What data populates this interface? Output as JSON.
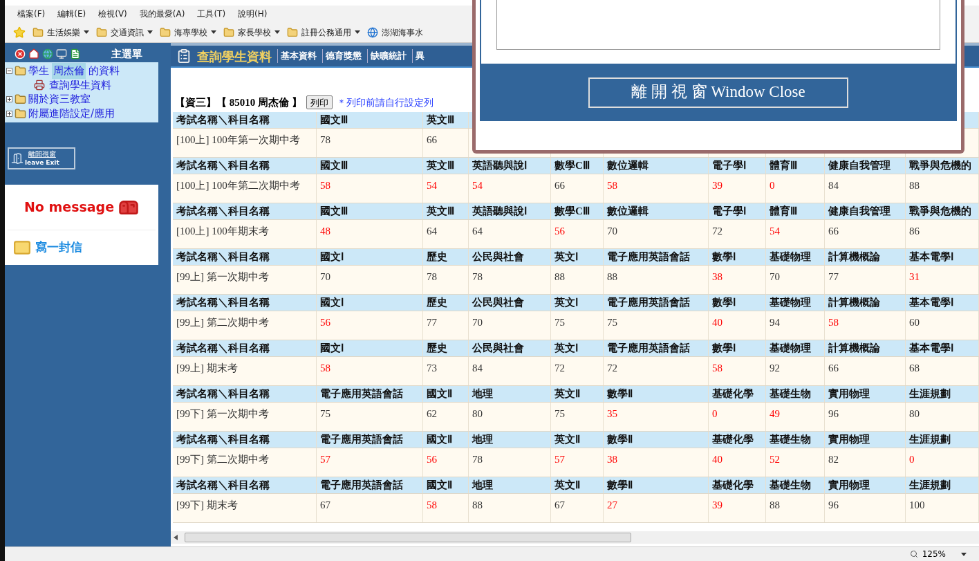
{
  "menu_bar": [
    "檔案(F)",
    "編輯(E)",
    "檢視(V)",
    "我的最愛(A)",
    "工具(T)",
    "說明(H)"
  ],
  "favorites_bar": [
    {
      "label": "生活娛樂",
      "kind": "folder"
    },
    {
      "label": "交通資訊",
      "kind": "folder"
    },
    {
      "label": "海專學校",
      "kind": "folder"
    },
    {
      "label": "家長學校",
      "kind": "folder"
    },
    {
      "label": "註冊公務通用",
      "kind": "folder"
    },
    {
      "label": "澎湖海事水",
      "kind": "page"
    }
  ],
  "sidebar": {
    "title": "主選單",
    "tree": [
      {
        "label_before": "學生",
        "highlight": "周杰倫",
        "label_after": "的資料",
        "expanded": true,
        "children": [
          {
            "label": "查詢學生資料"
          }
        ]
      },
      {
        "label_before": "關於資三教室",
        "expanded": false
      },
      {
        "label_before": "附屬進階設定/應用",
        "expanded": false
      }
    ],
    "leave_button": {
      "line1": "離開視窗",
      "line2": "leave Exit"
    },
    "message": "No message",
    "write_link": "寫一封信"
  },
  "header": {
    "title": "查詢學生資料",
    "tabs": [
      "基本資料",
      "德育獎懲",
      "缺曠統計",
      "異"
    ]
  },
  "student_line": {
    "class_name": "【資三】【 85010 周杰倫 】",
    "print_button": "列印",
    "note": "＊列印前請自行設定列"
  },
  "blocks": [
    {
      "headers": [
        "考試名稱＼科目名稱",
        "國文Ⅲ",
        "英文Ⅲ"
      ],
      "exam": "[100上] 100年第一次期中考",
      "scores": [
        {
          "value": "78",
          "fail": false
        },
        {
          "value": "66",
          "fail": false
        }
      ]
    },
    {
      "headers": [
        "考試名稱＼科目名稱",
        "國文Ⅲ",
        "英文Ⅲ",
        "英語聽與說Ⅰ",
        "數學CⅢ",
        "數位邏輯",
        "電子學Ⅰ",
        "體育Ⅲ",
        "健康自我管理",
        "戰爭與危機的"
      ],
      "exam": "[100上] 100年第二次期中考",
      "scores": [
        {
          "value": "58",
          "fail": true
        },
        {
          "value": "54",
          "fail": true
        },
        {
          "value": "54",
          "fail": true
        },
        {
          "value": "66",
          "fail": false
        },
        {
          "value": "58",
          "fail": true
        },
        {
          "value": "39",
          "fail": true
        },
        {
          "value": "0",
          "fail": true
        },
        {
          "value": "84",
          "fail": false
        },
        {
          "value": "88",
          "fail": false
        }
      ]
    },
    {
      "headers": [
        "考試名稱＼科目名稱",
        "國文Ⅲ",
        "英文Ⅲ",
        "英語聽與說Ⅰ",
        "數學CⅢ",
        "數位邏輯",
        "電子學Ⅰ",
        "體育Ⅲ",
        "健康自我管理",
        "戰爭與危機的"
      ],
      "exam": "[100上] 100年期末考",
      "scores": [
        {
          "value": "48",
          "fail": true
        },
        {
          "value": "64",
          "fail": false
        },
        {
          "value": "64",
          "fail": false
        },
        {
          "value": "56",
          "fail": true
        },
        {
          "value": "70",
          "fail": false
        },
        {
          "value": "72",
          "fail": false
        },
        {
          "value": "54",
          "fail": true
        },
        {
          "value": "66",
          "fail": false
        },
        {
          "value": "86",
          "fail": false
        }
      ]
    },
    {
      "headers": [
        "考試名稱＼科目名稱",
        "國文Ⅰ",
        "歷史",
        "公民與社會",
        "英文Ⅰ",
        "電子應用英語會話",
        "數學Ⅰ",
        "基礎物理",
        "計算機概論",
        "基本電學Ⅰ"
      ],
      "exam": "[99上] 第一次期中考",
      "scores": [
        {
          "value": "70",
          "fail": false
        },
        {
          "value": "78",
          "fail": false
        },
        {
          "value": "78",
          "fail": false
        },
        {
          "value": "88",
          "fail": false
        },
        {
          "value": "88",
          "fail": false
        },
        {
          "value": "38",
          "fail": true
        },
        {
          "value": "70",
          "fail": false
        },
        {
          "value": "77",
          "fail": false
        },
        {
          "value": "31",
          "fail": true
        }
      ]
    },
    {
      "headers": [
        "考試名稱＼科目名稱",
        "國文Ⅰ",
        "歷史",
        "公民與社會",
        "英文Ⅰ",
        "電子應用英語會話",
        "數學Ⅰ",
        "基礎物理",
        "計算機概論",
        "基本電學Ⅰ"
      ],
      "exam": "[99上] 第二次期中考",
      "scores": [
        {
          "value": "56",
          "fail": true
        },
        {
          "value": "77",
          "fail": false
        },
        {
          "value": "70",
          "fail": false
        },
        {
          "value": "75",
          "fail": false
        },
        {
          "value": "75",
          "fail": false
        },
        {
          "value": "40",
          "fail": true
        },
        {
          "value": "94",
          "fail": false
        },
        {
          "value": "58",
          "fail": true
        },
        {
          "value": "60",
          "fail": false
        }
      ]
    },
    {
      "headers": [
        "考試名稱＼科目名稱",
        "國文Ⅰ",
        "歷史",
        "公民與社會",
        "英文Ⅰ",
        "電子應用英語會話",
        "數學Ⅰ",
        "基礎物理",
        "計算機概論",
        "基本電學Ⅰ"
      ],
      "exam": "[99上] 期末考",
      "scores": [
        {
          "value": "58",
          "fail": true
        },
        {
          "value": "73",
          "fail": false
        },
        {
          "value": "84",
          "fail": false
        },
        {
          "value": "72",
          "fail": false
        },
        {
          "value": "72",
          "fail": false
        },
        {
          "value": "58",
          "fail": true
        },
        {
          "value": "92",
          "fail": false
        },
        {
          "value": "66",
          "fail": false
        },
        {
          "value": "68",
          "fail": false
        }
      ]
    },
    {
      "headers": [
        "考試名稱＼科目名稱",
        "電子應用英語會話",
        "國文Ⅱ",
        "地理",
        "英文Ⅱ",
        "數學Ⅱ",
        "基礎化學",
        "基礎生物",
        "實用物理",
        "生涯規劃"
      ],
      "exam": "[99下] 第一次期中考",
      "scores": [
        {
          "value": "75",
          "fail": false
        },
        {
          "value": "62",
          "fail": false
        },
        {
          "value": "80",
          "fail": false
        },
        {
          "value": "75",
          "fail": false
        },
        {
          "value": "35",
          "fail": true
        },
        {
          "value": "0",
          "fail": true
        },
        {
          "value": "49",
          "fail": true
        },
        {
          "value": "96",
          "fail": false
        },
        {
          "value": "80",
          "fail": false
        }
      ]
    },
    {
      "headers": [
        "考試名稱＼科目名稱",
        "電子應用英語會話",
        "國文Ⅱ",
        "地理",
        "英文Ⅱ",
        "數學Ⅱ",
        "基礎化學",
        "基礎生物",
        "實用物理",
        "生涯規劃"
      ],
      "exam": "[99下] 第二次期中考",
      "scores": [
        {
          "value": "57",
          "fail": true
        },
        {
          "value": "56",
          "fail": true
        },
        {
          "value": "78",
          "fail": false
        },
        {
          "value": "57",
          "fail": true
        },
        {
          "value": "38",
          "fail": true
        },
        {
          "value": "40",
          "fail": true
        },
        {
          "value": "52",
          "fail": true
        },
        {
          "value": "82",
          "fail": false
        },
        {
          "value": "0",
          "fail": true
        }
      ]
    },
    {
      "headers": [
        "考試名稱＼科目名稱",
        "電子應用英語會話",
        "國文Ⅱ",
        "地理",
        "英文Ⅱ",
        "數學Ⅱ",
        "基礎化學",
        "基礎生物",
        "實用物理",
        "生涯規劃"
      ],
      "exam": "[99下] 期末考",
      "scores": [
        {
          "value": "67",
          "fail": false
        },
        {
          "value": "58",
          "fail": true
        },
        {
          "value": "88",
          "fail": false
        },
        {
          "value": "67",
          "fail": false
        },
        {
          "value": "27",
          "fail": true
        },
        {
          "value": "39",
          "fail": true
        },
        {
          "value": "88",
          "fail": false
        },
        {
          "value": "96",
          "fail": false
        },
        {
          "value": "100",
          "fail": false
        }
      ]
    }
  ],
  "popup": {
    "close_button": "離 開 視 窗 Window Close"
  },
  "status_bar": {
    "zoom": "125%"
  }
}
